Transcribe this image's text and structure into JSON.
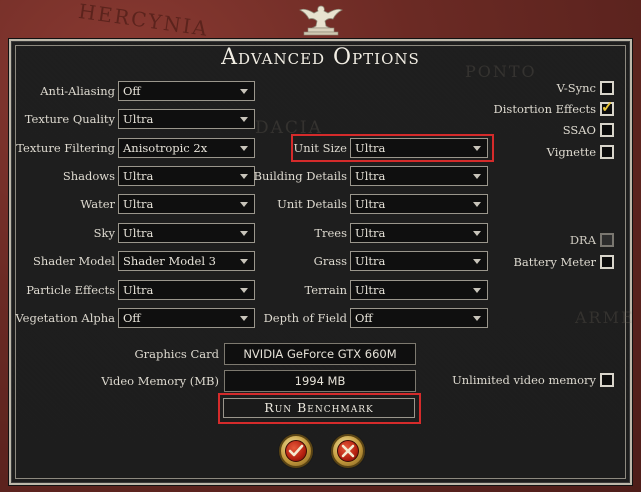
{
  "background_map_labels": [
    "HERCYNIA",
    "PONTO",
    "DACIA",
    "ARME"
  ],
  "title": "Advanced Options",
  "left_settings": [
    {
      "label": "Anti-Aliasing",
      "value": "Off"
    },
    {
      "label": "Texture Quality",
      "value": "Ultra"
    },
    {
      "label": "Texture Filtering",
      "value": "Anisotropic 2x"
    },
    {
      "label": "Shadows",
      "value": "Ultra"
    },
    {
      "label": "Water",
      "value": "Ultra"
    },
    {
      "label": "Sky",
      "value": "Ultra"
    },
    {
      "label": "Shader Model",
      "value": "Shader Model 3"
    },
    {
      "label": "Particle Effects",
      "value": "Ultra"
    },
    {
      "label": "Vegetation Alpha",
      "value": "Off"
    }
  ],
  "mid_settings": [
    {
      "label": "Unit Size",
      "value": "Ultra"
    },
    {
      "label": "Building Details",
      "value": "Ultra"
    },
    {
      "label": "Unit Details",
      "value": "Ultra"
    },
    {
      "label": "Trees",
      "value": "Ultra"
    },
    {
      "label": "Grass",
      "value": "Ultra"
    },
    {
      "label": "Terrain",
      "value": "Ultra"
    },
    {
      "label": "Depth of Field",
      "value": "Off"
    }
  ],
  "checkboxes": [
    {
      "label": "V-Sync",
      "checked": false
    },
    {
      "label": "Distortion Effects",
      "checked": true
    },
    {
      "label": "SSAO",
      "checked": false
    },
    {
      "label": "Vignette",
      "checked": false
    },
    {
      "label": "DRA",
      "checked": false,
      "disabled": true
    },
    {
      "label": "Battery Meter",
      "checked": false
    },
    {
      "label": "Unlimited video memory",
      "checked": false
    }
  ],
  "graphics_card": {
    "label": "Graphics Card",
    "value": "NVIDIA GeForce GTX 660M"
  },
  "video_memory": {
    "label": "Video Memory (MB)",
    "value": "1994 MB"
  },
  "benchmark_label": "Run Benchmark",
  "icons": {
    "confirm": "checkmark-icon",
    "cancel": "close-icon",
    "emblem": "eagle-icon"
  },
  "colors": {
    "highlight": "#d52b2b",
    "check": "#e9c63a"
  }
}
